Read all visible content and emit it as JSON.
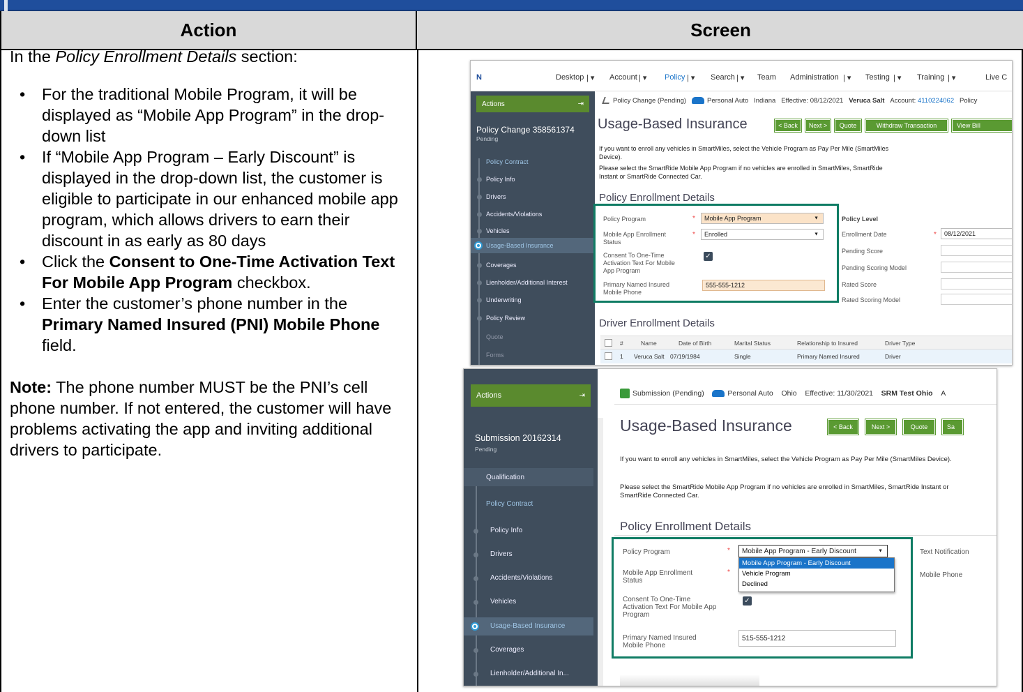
{
  "table": {
    "header_action": "Action",
    "header_screen": "Screen"
  },
  "action": {
    "intro_pre": "In the ",
    "intro_section": "Policy Enrollment Details",
    "intro_post": " section:",
    "bullets": {
      "b1": "For the traditional Mobile Program, it will be displayed as “Mobile App Program” in the drop-down list",
      "b2": "If “Mobile App Program – Early Discount” is displayed in the drop-down list, the customer is eligible to participate in our enhanced mobile app program, which allows drivers to earn their discount in as early as 80 days",
      "b3_pre": "Click the ",
      "b3_bold": "Consent to One-Time Activation Text For Mobile App Program",
      "b3_post": " checkbox.",
      "b4_pre": "Enter the customer’s phone number in the ",
      "b4_bold": "Primary Named Insured (PNI) Mobile Phone",
      "b4_post": " field."
    },
    "note_label": "Note:",
    "note_text": " The phone number MUST be the PNI’s cell phone number. If not entered, the customer will have problems activating the app and inviting additional drivers to participate."
  },
  "screen1": {
    "nav": {
      "logo": "N",
      "desktop": "Desktop",
      "account": "Account",
      "policy": "Policy",
      "search": "Search",
      "team": "Team",
      "administration": "Administration",
      "testing": "Testing",
      "training": "Training",
      "live": "Live C"
    },
    "sidebar": {
      "actions": "Actions",
      "title": "Policy Change 358561374",
      "status": "Pending",
      "items": {
        "policy_contract": "Policy Contract",
        "policy_info": "Policy Info",
        "drivers": "Drivers",
        "accidents": "Accidents/Violations",
        "vehicles": "Vehicles",
        "ubi": "Usage-Based Insurance",
        "coverages": "Coverages",
        "lienholder": "Lienholder/Additional Interest",
        "underwriting": "Underwriting",
        "policy_review": "Policy Review",
        "quote": "Quote",
        "forms": "Forms"
      }
    },
    "crumb": {
      "job": "Policy Change (Pending)",
      "product": "Personal Auto",
      "state": "Indiana",
      "effective": "Effective: 08/12/2021",
      "insured": "Veruca Salt",
      "account_label": "Account:",
      "account_no": "4110224062",
      "policy": "Policy"
    },
    "title": "Usage-Based Insurance",
    "buttons": {
      "back": "< Back",
      "next": "Next >",
      "quote": "Quote",
      "withdraw": "Withdraw Transaction",
      "view": "View Bill"
    },
    "info1": "If you want to enroll any vehicles in SmartMiles, select the Vehicle Program as Pay Per Mile (SmartMiles Device).",
    "info2": "Please select the SmartRide Mobile App Program if no vehicles are enrolled in SmartMiles, SmartRide Instant or SmartRide Connected Car.",
    "section": "Policy Enrollment Details",
    "fields": {
      "policy_program_label": "Policy Program",
      "policy_program_value": "Mobile App Program",
      "enroll_status_label": "Mobile App Enrollment Status",
      "enroll_status_value": "Enrolled",
      "consent_label": "Consent To One-Time Activation Text For Mobile App Program",
      "phone_label": "Primary Named Insured Mobile Phone",
      "phone_value": "555-555-1212"
    },
    "policy_level": {
      "heading": "Policy Level",
      "enroll_date_label": "Enrollment Date",
      "enroll_date_value": "08/12/2021",
      "pending_score": "Pending Score",
      "pending_model": "Pending Scoring Model",
      "rated_score": "Rated Score",
      "rated_model": "Rated Scoring Model"
    },
    "driver_section": "Driver Enrollment Details",
    "driver_table": {
      "col_num": "#",
      "col_name": "Name",
      "col_dob": "Date of Birth",
      "col_marital": "Marital Status",
      "col_rel": "Relationship to Insured",
      "col_type": "Driver Type",
      "row": {
        "num": "1",
        "name": "Veruca Salt",
        "dob": "07/19/1984",
        "marital": "Single",
        "rel": "Primary Named Insured",
        "type": "Driver"
      }
    }
  },
  "screen2": {
    "sidebar": {
      "actions": "Actions",
      "title": "Submission 20162314",
      "status": "Pending",
      "items": {
        "qualification": "Qualification",
        "policy_contract": "Policy Contract",
        "policy_info": "Policy Info",
        "drivers": "Drivers",
        "accidents": "Accidents/Violations",
        "vehicles": "Vehicles",
        "ubi": "Usage-Based Insurance",
        "coverages": "Coverages",
        "lienholder": "Lienholder/Additional In..."
      }
    },
    "crumb": {
      "job": "Submission (Pending)",
      "product": "Personal Auto",
      "state": "Ohio",
      "effective": "Effective: 11/30/2021",
      "insured": "SRM Test Ohio",
      "tail": "A"
    },
    "title": "Usage-Based Insurance",
    "buttons": {
      "back": "< Back",
      "next": "Next >",
      "quote": "Quote",
      "more": "Sa"
    },
    "info1": "If you want to enroll any vehicles in SmartMiles, select the Vehicle Program as Pay Per Mile (SmartMiles Device).",
    "info2": "Please select the SmartRide Mobile App Program if no vehicles are enrolled in SmartMiles, SmartRide Instant or SmartRide Connected Car.",
    "section": "Policy Enrollment Details",
    "fields": {
      "policy_program_label": "Policy Program",
      "policy_program_value": "Mobile App Program - Early Discount",
      "enroll_status_label": "Mobile App Enrollment Status",
      "consent_label": "Consent To One-Time Activation Text For Mobile App Program",
      "phone_label": "Primary Named Insured Mobile Phone",
      "phone_value": "515-555-1212"
    },
    "dropdown_options": {
      "opt1": "Mobile App Program - Early Discount",
      "opt2": "Vehicle Program",
      "opt3": "Declined"
    },
    "right_labels": {
      "text_notification": "Text Notification",
      "mobile_phone": "Mobile Phone"
    }
  },
  "colors": {
    "banner_blue": "#1f4e9c",
    "header_gray": "#d9d9d9",
    "sidebar": "#3f4d5c",
    "button_green": "#5a9a32",
    "highlight_teal": "#0f7c64",
    "dropdown_selected": "#1a74c9"
  }
}
